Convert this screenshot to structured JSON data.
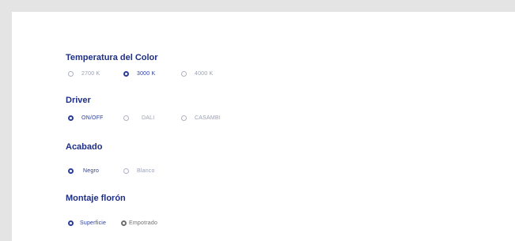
{
  "colors": {
    "accent": "#1e2f86",
    "selected": "#2a3d9e",
    "unselected": "#9aa0b2",
    "background": "#e4e4e4"
  },
  "groups": [
    {
      "title": "Temperatura del Color",
      "options": [
        {
          "label": "2700 K",
          "selected": false
        },
        {
          "label": "3000 K",
          "selected": true
        },
        {
          "label": "4000 K",
          "selected": false
        }
      ]
    },
    {
      "title": "Driver",
      "options": [
        {
          "label": "ON/OFF",
          "selected": true
        },
        {
          "label": "DALI",
          "selected": false
        },
        {
          "label": "CASAMBI",
          "selected": false
        }
      ]
    },
    {
      "title": "Acabado",
      "options": [
        {
          "label": "Negro",
          "selected": true
        },
        {
          "label": "Blanco",
          "selected": false
        }
      ]
    },
    {
      "title": "Montaje florón",
      "options": [
        {
          "label": "Superficie",
          "selected": true
        },
        {
          "label": "Empotrado",
          "selected": false
        }
      ]
    }
  ]
}
